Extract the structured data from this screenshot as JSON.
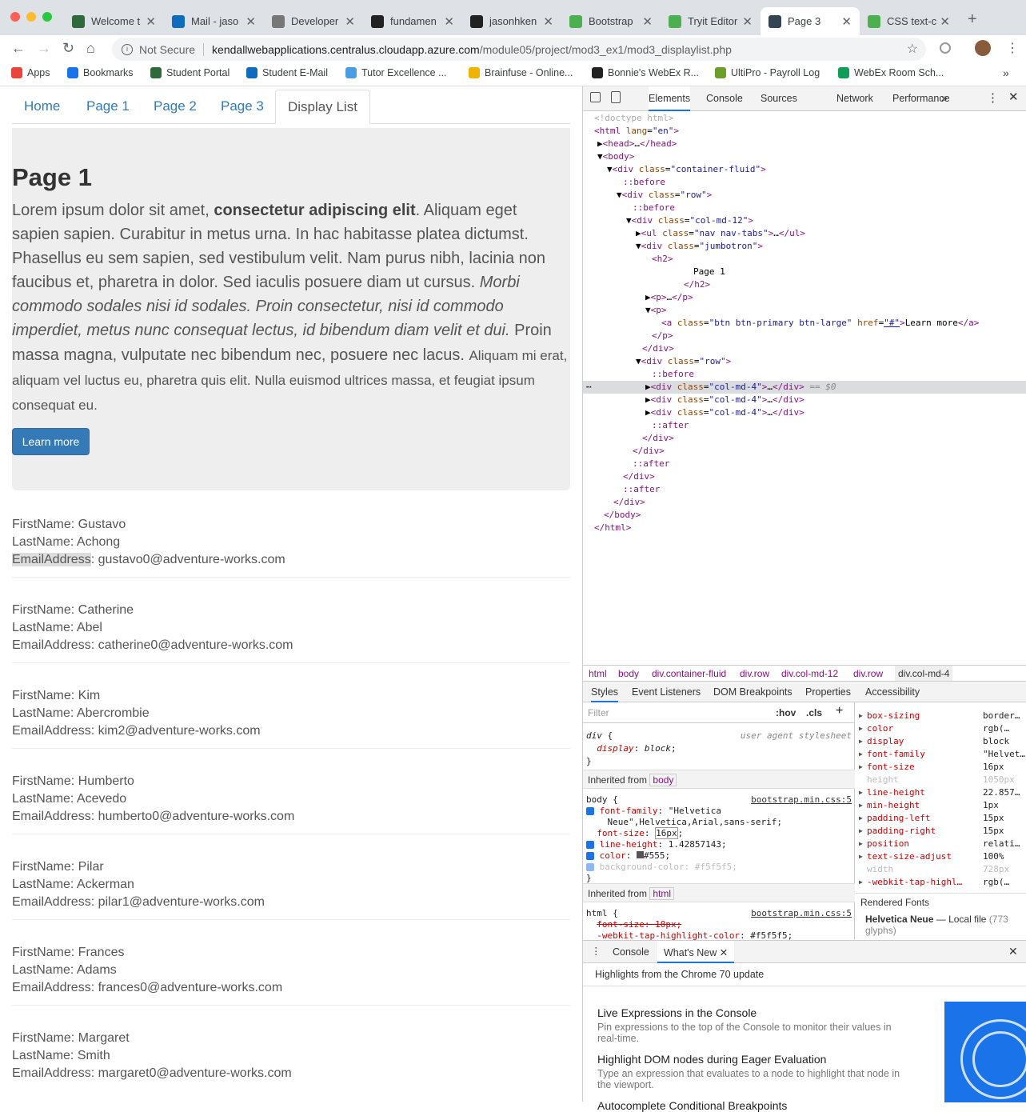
{
  "browser": {
    "tabs": [
      {
        "title": "Welcome t",
        "fav": "#2f6a3b"
      },
      {
        "title": "Mail - jaso",
        "fav": "#0f6cbd"
      },
      {
        "title": "Developer",
        "fav": "#777"
      },
      {
        "title": "fundamen",
        "fav": "#222"
      },
      {
        "title": "jasonhken",
        "fav": "#222"
      },
      {
        "title": "Bootstrap",
        "fav": "#4caf50"
      },
      {
        "title": "Tryit Editor",
        "fav": "#4caf50"
      },
      {
        "title": "Page 3",
        "fav": "#345"
      },
      {
        "title": "CSS text-c",
        "fav": "#4caf50"
      }
    ],
    "security": "Not Secure",
    "url_host": "kendallwebapplications.centralus.cloudapp.azure.com",
    "url_path": "/module05/project/mod3_ex1/mod3_displaylist.php",
    "bookmarks": [
      "Apps",
      "Bookmarks",
      "Student Portal",
      "Student E-Mail",
      "Tutor Excellence ...",
      "Brainfuse - Online...",
      "Bonnie's WebEx R...",
      "UltiPro - Payroll Log",
      "WebEx Room Sch..."
    ]
  },
  "page": {
    "nav": [
      "Home",
      "Page 1",
      "Page 2",
      "Page 3",
      "Display List"
    ],
    "heading": "Page 1",
    "para_a": "Lorem ipsum dolor sit amet, ",
    "para_b": "consectetur adipiscing elit",
    "para_c": ". Aliquam eget sapien sapien. Curabitur in metus urna. In hac habitasse platea dictumst. Phasellus eu sem sapien, sed vestibulum velit. Nam purus nibh, lacinia non faucibus et, pharetra in dolor. Sed iaculis posuere diam ut cursus. ",
    "para_d": "Morbi commodo sodales nisi id sodales. Proin consectetur, nisi id commodo imperdiet, metus nunc consequat lectus, id bibendum diam velit et dui.",
    "para_e": " Proin massa magna, vulputate nec bibendum nec, posuere nec lacus. ",
    "para_f": "Aliquam mi erat, aliquam vel luctus eu, pharetra quis elit. Nulla euismod ultrices massa, et feugiat ipsum consequat eu.",
    "button": "Learn more",
    "people": [
      {
        "first": "FirstName: Gustavo",
        "last": "LastName: Achong",
        "email_label": "EmailAddress",
        "email": ": gustavo0@adventure-works.com"
      },
      {
        "first": "FirstName: Catherine",
        "last": "LastName: Abel",
        "email_label": "EmailAddress",
        "email": ": catherine0@adventure-works.com"
      },
      {
        "first": "FirstName: Kim",
        "last": "LastName: Abercrombie",
        "email_label": "EmailAddress",
        "email": ": kim2@adventure-works.com"
      },
      {
        "first": "FirstName: Humberto",
        "last": "LastName: Acevedo",
        "email_label": "EmailAddress",
        "email": ": humberto0@adventure-works.com"
      },
      {
        "first": "FirstName: Pilar",
        "last": "LastName: Ackerman",
        "email_label": "EmailAddress",
        "email": ": pilar1@adventure-works.com"
      },
      {
        "first": "FirstName: Frances",
        "last": "LastName: Adams",
        "email_label": "EmailAddress",
        "email": ": frances0@adventure-works.com"
      },
      {
        "first": "FirstName: Margaret",
        "last": "LastName: Smith",
        "email_label": "EmailAddress",
        "email": ": margaret0@adventure-works.com"
      }
    ]
  },
  "devtools": {
    "tabs": [
      "Elements",
      "Console",
      "Sources",
      "Network",
      "Performance"
    ],
    "crumbs": [
      "html",
      "body",
      "div.container-fluid",
      "div.row",
      "div.col-md-12",
      "div.row",
      "div.col-md-4"
    ],
    "subtabs": [
      "Styles",
      "Event Listeners",
      "DOM Breakpoints",
      "Properties",
      "Accessibility"
    ],
    "filter": "Filter",
    "hov": ":hov",
    "cls": ".cls",
    "inherited_body": "Inherited from",
    "body": "body",
    "html": "html",
    "ua": "user agent stylesheet",
    "src": "bootstrap.min.css:5",
    "computed": [
      [
        "box-sizing",
        "border…"
      ],
      [
        "color",
        "rgb(…"
      ],
      [
        "display",
        "block"
      ],
      [
        "font-family",
        "\"Helvet…"
      ],
      [
        "font-size",
        "16px"
      ],
      [
        "height",
        "1050px"
      ],
      [
        "line-height",
        "22.857…"
      ],
      [
        "min-height",
        "1px"
      ],
      [
        "padding-left",
        "15px"
      ],
      [
        "padding-right",
        "15px"
      ],
      [
        "position",
        "relati…"
      ],
      [
        "text-size-adjust",
        "100%"
      ],
      [
        "width",
        "728px"
      ],
      [
        "-webkit-tap-highl…",
        "rgb(…"
      ]
    ],
    "rendered_fonts": "Rendered Fonts",
    "font_name": "Helvetica Neue",
    "font_src": "Local file",
    "font_glyphs": "(773 glyphs)",
    "drawer_tabs": [
      "Console",
      "What's New"
    ],
    "highlights": "Highlights from the Chrome 70 update",
    "news": [
      {
        "title": "Live Expressions in the Console",
        "body": "Pin expressions to the top of the Console to monitor their values in real-time."
      },
      {
        "title": "Highlight DOM nodes during Eager Evaluation",
        "body": "Type an expression that evaluates to a node to highlight that node in the viewport."
      },
      {
        "title": "Autocomplete Conditional Breakpoints",
        "body": ""
      }
    ]
  }
}
